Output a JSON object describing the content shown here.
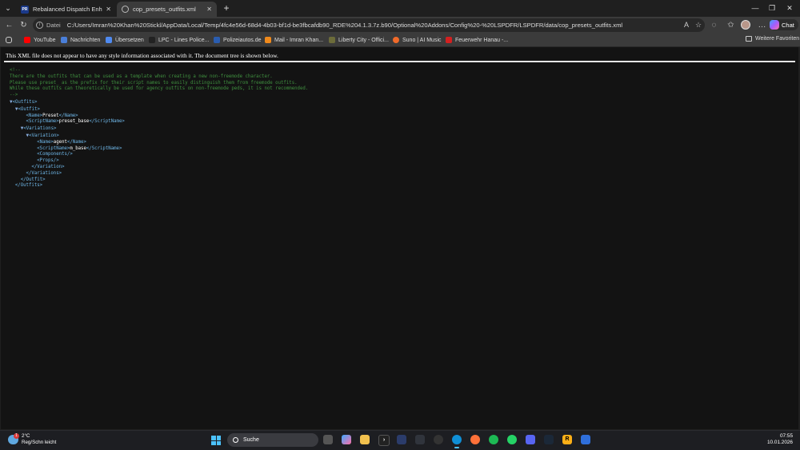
{
  "tabs": [
    {
      "title": "Rebalanced Dispatch Enhanced - L",
      "active": false
    },
    {
      "title": "cop_presets_outfits.xml",
      "active": true
    }
  ],
  "address": {
    "scheme": "Datei",
    "url": "C:/Users/Imran%20Khan%20Stickl/AppData/Local/Temp/4fc4e56d-68d4-4b03-bf1d-be3fbcafdb90_RDE%204.1.3.7z.b90/Optional%20Addons/Config%20-%20LSPDFR/LSPDFR/data/cop_presets_outfits.xml"
  },
  "copilot_label": "Chat",
  "bookmarks": [
    {
      "label": "YouTube",
      "icon": "youtube-icon",
      "color": "#ff0000"
    },
    {
      "label": "Nachrichten",
      "icon": "news-icon",
      "color": "#4a7fd9"
    },
    {
      "label": "Übersetzen",
      "icon": "translate-icon",
      "color": "#4f8af0"
    },
    {
      "label": "LPC - Lines Police...",
      "icon": "lpc-icon",
      "color": "#222222"
    },
    {
      "label": "Polizeiautos.de",
      "icon": "polizeiautos-icon",
      "color": "#2a5db0"
    },
    {
      "label": "Mail - Imran Khan...",
      "icon": "mail-icon",
      "color": "#f08a1c"
    },
    {
      "label": "Liberty City - Offici...",
      "icon": "liberty-city-icon",
      "color": "#6c6c3a"
    },
    {
      "label": "Suno | AI Music",
      "icon": "suno-icon",
      "color": "#f06a2a"
    },
    {
      "label": "Feuerwehr Hanau -...",
      "icon": "feuerwehr-icon",
      "color": "#d32020"
    }
  ],
  "bookmarks_folder": "Weitere Favoriten",
  "xml": {
    "info": "This XML file does not appear to have any style information associated with it. The document tree is shown below.",
    "comment": [
      "<!--",
      "There are the outfits that can be used as a template when creating a new non-freemode character.",
      "Please use preset_ as the prefix for their script names to easily distinguish them from freemode outfits.",
      "While these outfits can theoretically be used for agency outfits on non-freemode peds, it is not recommended.",
      "-->"
    ],
    "outfits_open": "<Outfits>",
    "outfit_open": "<Outfit>",
    "name_open": "<Name>",
    "name_value": "Preset",
    "name_close": "</Name>",
    "scriptname_open": "<ScriptName>",
    "scriptname_value": "preset_base",
    "scriptname_close": "</ScriptName>",
    "variations_open": "<Variations>",
    "variation_open": "<Variation>",
    "var_name_value": "agent",
    "var_scriptname_value": "m_base",
    "components": "<Components/>",
    "props": "<Props/>",
    "variation_close": "</Variation>",
    "variations_close": "</Variations>",
    "outfit_close": "</Outfit>",
    "outfits_close": "</Outfits>"
  },
  "taskbar": {
    "weather_temp": "2°C",
    "weather_desc": "Reg/Schn leicht",
    "weather_badge": "1",
    "search_label": "Suche",
    "time": "07:55",
    "date": "10.01.2026"
  }
}
